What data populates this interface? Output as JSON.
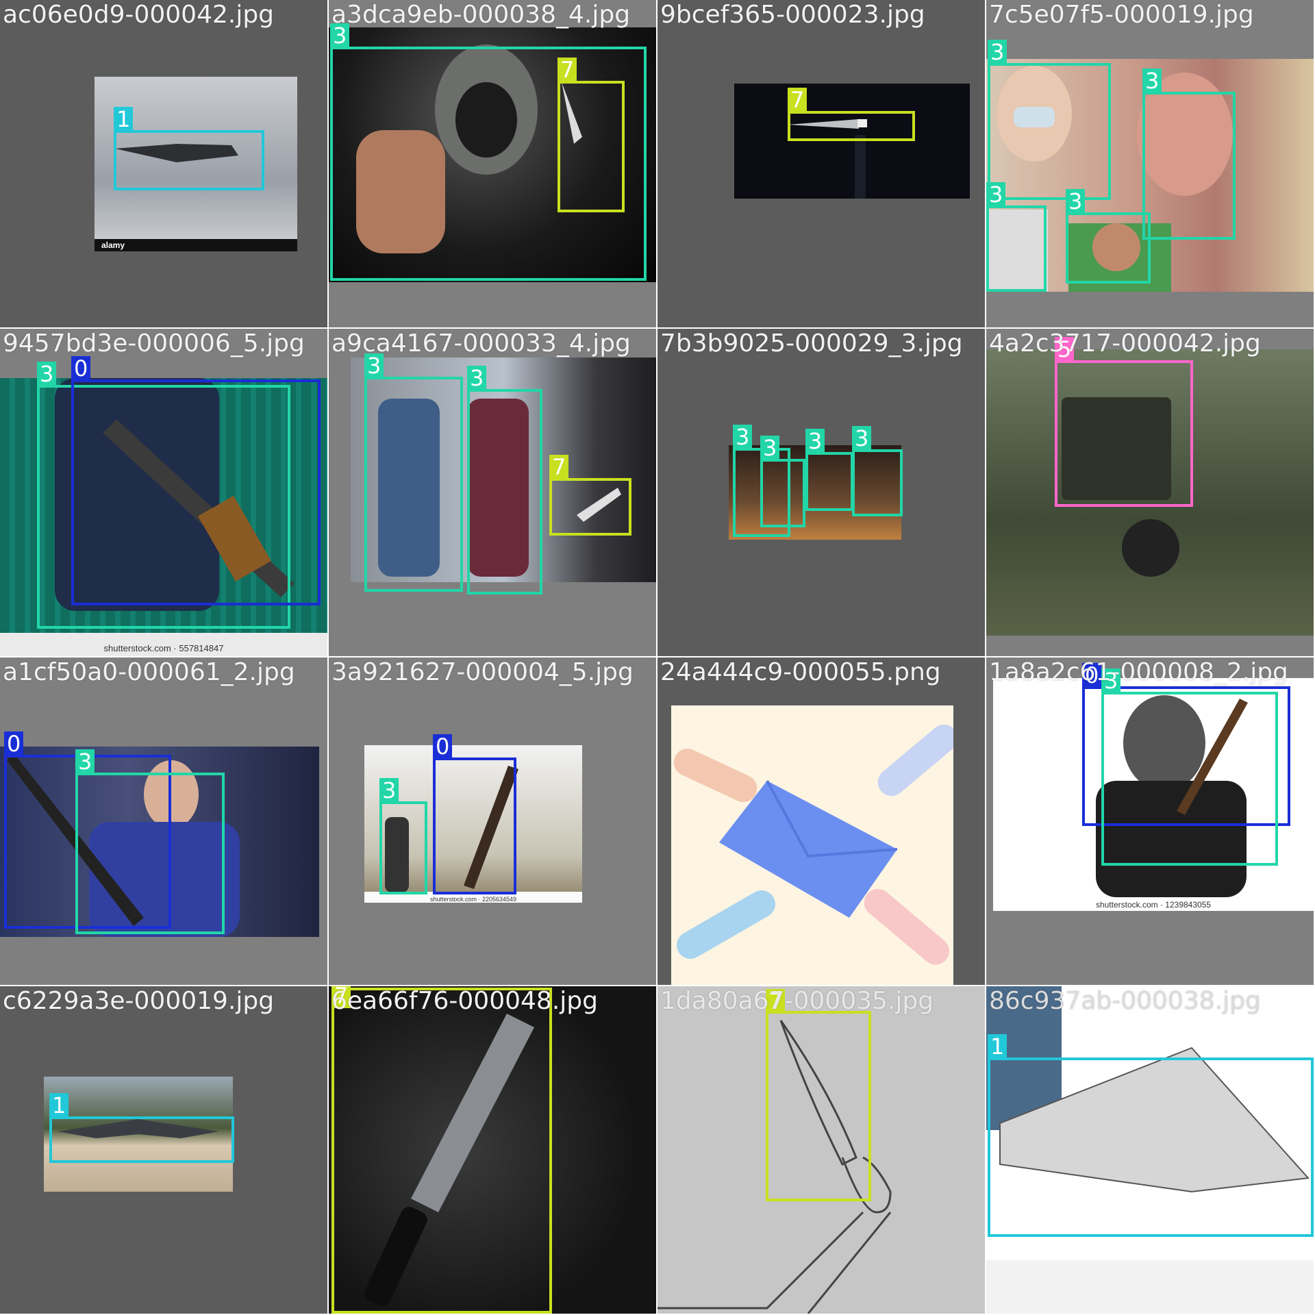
{
  "colors": {
    "class_0": "#1a2ed6",
    "class_1": "#21c8d8",
    "class_3": "#22d6a8",
    "class_5": "#ff66cc",
    "class_7": "#c8e020"
  },
  "tiles": [
    {
      "filename": "ac06e0d9-000042.jpg",
      "labels": [
        "1"
      ],
      "watermark_brand": "alamy",
      "watermark_corner": "alamy"
    },
    {
      "filename": "a3dca9eb-000038_4.jpg",
      "labels": [
        "3",
        "7"
      ]
    },
    {
      "filename": "9bcef365-000023.jpg",
      "labels": [
        "7"
      ]
    },
    {
      "filename": "7c5e07f5-000019.jpg",
      "labels": [
        "3",
        "3",
        "3",
        "3"
      ]
    },
    {
      "filename": "9457bd3e-000006_5.jpg",
      "labels": [
        "3",
        "0"
      ],
      "watermark": "shutterstock.com · 557814847"
    },
    {
      "filename": "a9ca4167-000033_4.jpg",
      "labels": [
        "3",
        "3",
        "7"
      ]
    },
    {
      "filename": "7b3b9025-000029_3.jpg",
      "labels": [
        "3",
        "3",
        "3",
        "3"
      ]
    },
    {
      "filename": "4a2c3717-000042.jpg",
      "labels": [
        "5"
      ]
    },
    {
      "filename": "a1cf50a0-000061_2.jpg",
      "labels": [
        "0",
        "3"
      ]
    },
    {
      "filename": "3a921627-000004_5.jpg",
      "labels": [
        "3",
        "0"
      ],
      "watermark": "shutterstock.com · 2205634549"
    },
    {
      "filename": "24a444c9-000055.png",
      "labels": []
    },
    {
      "filename": "1a8a2c61-000008_2.jpg",
      "labels": [
        "0",
        "3"
      ],
      "watermark": "shutterstock.com · 1239843055"
    },
    {
      "filename": "c6229a3e-000019.jpg",
      "labels": [
        "1"
      ]
    },
    {
      "filename": "6ea66f76-000048.jpg",
      "labels": [
        "7"
      ]
    },
    {
      "filename": "1da80a67-000035.jpg",
      "labels": [
        "7"
      ]
    },
    {
      "filename": "86c937ab-000038.jpg",
      "labels": [
        "1"
      ]
    }
  ]
}
